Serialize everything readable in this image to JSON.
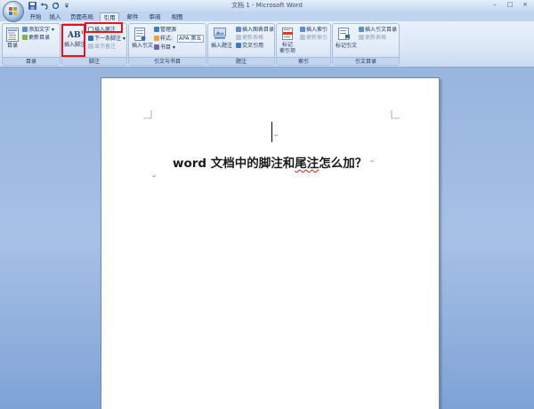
{
  "window": {
    "title": "文档 1 - Microsoft Word",
    "minimize": "–",
    "maximize": "□",
    "close": "×"
  },
  "quick_access": {
    "save_icon": "save-icon",
    "undo_icon": "undo-icon",
    "redo_icon": "redo-icon",
    "customize_icon": "dropdown-icon"
  },
  "tabs": [
    {
      "label": "开始"
    },
    {
      "label": "插入"
    },
    {
      "label": "页面布局"
    },
    {
      "label": "引用"
    },
    {
      "label": "邮件"
    },
    {
      "label": "审阅"
    },
    {
      "label": "视图"
    }
  ],
  "ribbon": {
    "toc": {
      "group_label": "目录",
      "toc_button": "目录",
      "add_text": "添加文字 ▾",
      "update_toc": "更新目录"
    },
    "footnotes": {
      "group_label": "脚注",
      "insert_footnote": "插入脚注",
      "insert_footnote_icon_text": "AB",
      "insert_footnote_icon_sup": "1",
      "insert_endnote": "插入尾注",
      "next_footnote": "下一条脚注 ▾",
      "show_notes": "显示备注"
    },
    "citations": {
      "group_label": "引文与书目",
      "insert_citation": "插入引文",
      "manage_sources": "管理源",
      "style_label": "样式:",
      "style_value": "APA 第五",
      "bibliography": "书目 ▾"
    },
    "captions": {
      "group_label": "题注",
      "insert_caption": "插入题注",
      "insert_table_of_figures": "插入图表目录",
      "update_table": "更新表格",
      "cross_reference": "交叉引用"
    },
    "index": {
      "group_label": "索引",
      "mark_entry": "标记\n索引项",
      "mark_entry_line1": "标记",
      "mark_entry_line2": "索引项",
      "insert_index": "插入索引",
      "update_index": "更新索引"
    },
    "toa": {
      "group_label": "引文目录",
      "mark_citation": "标记引文",
      "insert_toa": "插入引文目录",
      "update_table": "更新表格"
    }
  },
  "document": {
    "title_line": {
      "part1": "word 文档中的脚注和",
      "part2": "尾注",
      "part3": "怎么加？"
    },
    "para_mark": "↵"
  },
  "colors": {
    "highlight": "#e8141b",
    "ribbon_bg": "#dce8f8",
    "workspace_bg": "#97b5de"
  }
}
